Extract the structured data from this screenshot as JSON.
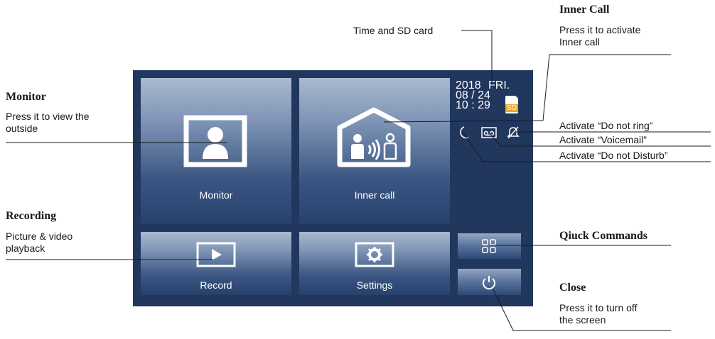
{
  "device": {
    "tiles": {
      "monitor": "Monitor",
      "inner_call": "Inner call",
      "record": "Record",
      "settings": "Settings"
    },
    "status": {
      "year": "2018",
      "weekday": "FRI.",
      "date": "08 / 24",
      "time": "10 : 29",
      "sd": "SD"
    },
    "icons": [
      "do-not-disturb-moon",
      "voicemail",
      "do-not-ring-bell",
      "quick-commands-grid",
      "power"
    ],
    "colors": {
      "panel": "#21375e",
      "sd_badge": "#f0a630"
    }
  },
  "annotations": {
    "time_sd": "Time and SD card",
    "inner_call": {
      "title": "Inner Call",
      "line1": "Press it to activate",
      "line2": "Inner call"
    },
    "monitor": {
      "title": "Monitor",
      "line1": "Press it to view the",
      "line2": "outside"
    },
    "recording": {
      "title": "Recording",
      "line1": "Picture & video",
      "line2": "playback"
    },
    "do_not_ring": "Activate “Do not ring”",
    "voicemail": "Activate “Voicemail”",
    "do_not_disturb": "Activate “Do not Disturb”",
    "quick": {
      "title": "Qiuck Commands"
    },
    "close": {
      "title": "Close",
      "line1": "Press it to turn off",
      "line2": "the screen"
    }
  }
}
